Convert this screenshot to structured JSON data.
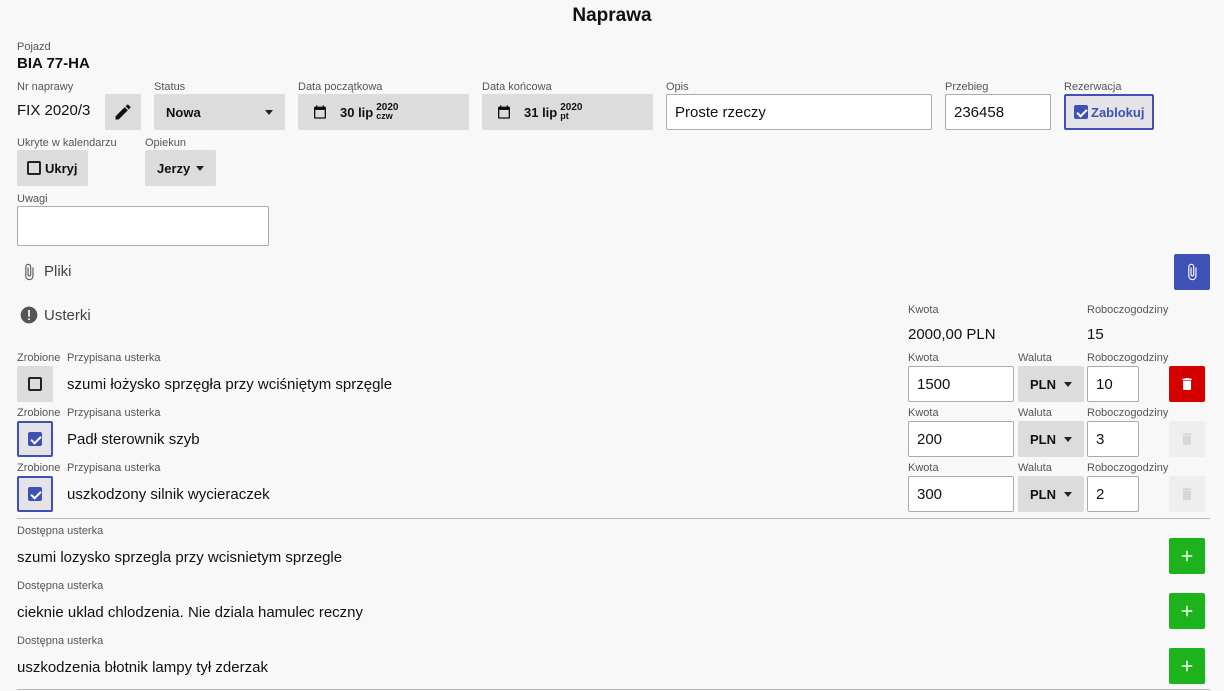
{
  "header": {
    "title": "Naprawa"
  },
  "vehicle": {
    "label": "Pojazd",
    "value": "BIA 77-HA"
  },
  "repair_number": {
    "label": "Nr naprawy",
    "value": "FIX 2020/3"
  },
  "status": {
    "label": "Status",
    "value": "Nowa"
  },
  "start_date": {
    "label": "Data początkowa",
    "day": "30 lip",
    "year": "2020",
    "weekday": "czw"
  },
  "end_date": {
    "label": "Data końcowa",
    "day": "31 lip",
    "year": "2020",
    "weekday": "pt"
  },
  "description": {
    "label": "Opis",
    "value": "Proste rzeczy"
  },
  "mileage": {
    "label": "Przebieg",
    "value": "236458"
  },
  "reservation": {
    "label": "Rezerwacja",
    "button": "Zablokuj",
    "checked": true
  },
  "hidden_calendar": {
    "label": "Ukryte w kalendarzu",
    "button": "Ukryj",
    "checked": false
  },
  "caretaker": {
    "label": "Opiekun",
    "value": "Jerzy"
  },
  "notes": {
    "label": "Uwagi",
    "value": ""
  },
  "files": {
    "label": "Pliki"
  },
  "faults": {
    "label": "Usterki",
    "amount_label": "Kwota",
    "amount_total": "2000,00 PLN",
    "hours_label": "Roboczogodziny",
    "hours_total": "15"
  },
  "assigned_labels": {
    "done": "Zrobione",
    "fault": "Przypisana usterka",
    "amount": "Kwota",
    "currency": "Waluta",
    "hours": "Roboczogodziny"
  },
  "assigned": [
    {
      "done": false,
      "name": "szumi łożysko sprzęgła przy wciśniętym sprzęgle",
      "amount": "1500",
      "currency": "PLN",
      "hours": "10",
      "deletable": true
    },
    {
      "done": true,
      "name": "Padł sterownik szyb",
      "amount": "200",
      "currency": "PLN",
      "hours": "3",
      "deletable": false
    },
    {
      "done": true,
      "name": "uszkodzony silnik wycieraczek",
      "amount": "300",
      "currency": "PLN",
      "hours": "2",
      "deletable": false
    }
  ],
  "available_label": "Dostępna usterka",
  "available": [
    {
      "name": "szumi lozysko sprzegla przy wcisnietym sprzegle"
    },
    {
      "name": "cieknie uklad chlodzenia. Nie dziala hamulec reczny"
    },
    {
      "name": "uszkodzenia błotnik lampy tył zderzak"
    }
  ],
  "colors": {
    "accent": "#3f51b5",
    "danger": "#d50000",
    "success": "#1db31d"
  }
}
